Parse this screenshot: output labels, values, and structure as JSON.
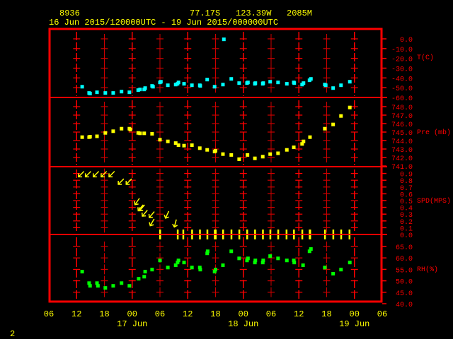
{
  "header": {
    "station": "8936",
    "latitude": "77.17S",
    "longitude": "123.39W",
    "elevation": "2085M",
    "period": "16 Jun 2015/120000UTC - 19 Jun 2015/000000UTC"
  },
  "footer": {
    "page_number": "2"
  },
  "colors": {
    "frame": "#ff0000",
    "text": "#ffff00",
    "temperature": "#00ffff",
    "pressure": "#ffff00",
    "wind": "#ffff00",
    "humidity": "#00ff00"
  },
  "chart_data": {
    "type": "scatter",
    "x_axis": {
      "unit": "hours since 16 Jun 2015 00UTC",
      "range": [
        6,
        78
      ],
      "ticks": [
        {
          "h": 6,
          "label": "06"
        },
        {
          "h": 12,
          "label": "12"
        },
        {
          "h": 18,
          "label": "18"
        },
        {
          "h": 24,
          "label": "00"
        },
        {
          "h": 30,
          "label": "06"
        },
        {
          "h": 36,
          "label": "12"
        },
        {
          "h": 42,
          "label": "18"
        },
        {
          "h": 48,
          "label": "00"
        },
        {
          "h": 54,
          "label": "06"
        },
        {
          "h": 60,
          "label": "12"
        },
        {
          "h": 66,
          "label": "18"
        },
        {
          "h": 72,
          "label": "00"
        },
        {
          "h": 78,
          "label": "06"
        }
      ],
      "date_labels": [
        {
          "h": 24,
          "label": "17 Jun"
        },
        {
          "h": 48,
          "label": "18 Jun"
        },
        {
          "h": 72,
          "label": "19 Jun"
        }
      ]
    },
    "panels": [
      {
        "name": "temperature",
        "label": "T(C)",
        "ylim": [
          -60,
          0
        ],
        "tick_labels": [
          "0.0",
          "-10.0",
          "-20.0",
          "-30.0",
          "-40.0",
          "-50.0",
          "-60.0"
        ],
        "points": [
          [
            13.2,
            -49
          ],
          [
            14.7,
            -55.4
          ],
          [
            14.9,
            -56
          ],
          [
            16.4,
            -54.7
          ],
          [
            18.2,
            -55.4
          ],
          [
            19.9,
            -55.4
          ],
          [
            21.7,
            -54
          ],
          [
            23.4,
            -54.7
          ],
          [
            25.3,
            -52.5
          ],
          [
            25.7,
            -51.8
          ],
          [
            26.6,
            -51.8
          ],
          [
            26.8,
            -50.4
          ],
          [
            28.3,
            -48.2
          ],
          [
            28.5,
            -49
          ],
          [
            30.0,
            -44.6
          ],
          [
            30.2,
            -43.9
          ],
          [
            31.7,
            -47.5
          ],
          [
            33.4,
            -46.8
          ],
          [
            33.8,
            -46
          ],
          [
            34.0,
            -44.6
          ],
          [
            35.2,
            -46
          ],
          [
            36.9,
            -47.5
          ],
          [
            38.6,
            -47.5
          ],
          [
            38.7,
            -48.2
          ],
          [
            40.2,
            -41.7
          ],
          [
            41.8,
            -49
          ],
          [
            43.6,
            -46.8
          ],
          [
            43.8,
            -0.5
          ],
          [
            45.4,
            -41
          ],
          [
            47.1,
            -45.3
          ],
          [
            48.8,
            -45.3
          ],
          [
            49.0,
            -44.6
          ],
          [
            50.5,
            -46
          ],
          [
            50.6,
            -45.3
          ],
          [
            52.2,
            -46
          ],
          [
            52.3,
            -45.3
          ],
          [
            53.8,
            -43.9
          ],
          [
            55.5,
            -44.6
          ],
          [
            57.4,
            -46
          ],
          [
            58.9,
            -44.6
          ],
          [
            59.0,
            -45.3
          ],
          [
            60.7,
            -46.8
          ],
          [
            61.0,
            -45.3
          ],
          [
            62.3,
            -42.4
          ],
          [
            62.6,
            -41
          ],
          [
            65.6,
            -46.8
          ],
          [
            65.8,
            -47.5
          ],
          [
            67.4,
            -50.4
          ],
          [
            69.1,
            -47.5
          ],
          [
            71.0,
            -43.9
          ]
        ]
      },
      {
        "name": "pressure",
        "label": "Pre (mb)",
        "ylim": [
          741,
          748
        ],
        "tick_labels": [
          "748.0",
          "747.0",
          "746.0",
          "745.0",
          "744.0",
          "743.0",
          "742.0",
          "741.0"
        ],
        "points": [
          [
            13.2,
            744.4
          ],
          [
            14.7,
            744.4
          ],
          [
            14.9,
            744.45
          ],
          [
            16.4,
            744.5
          ],
          [
            18.2,
            744.9
          ],
          [
            19.9,
            745.1
          ],
          [
            21.7,
            745.4
          ],
          [
            23.4,
            745.4
          ],
          [
            23.6,
            745.3
          ],
          [
            25.3,
            744.9
          ],
          [
            25.7,
            744.85
          ],
          [
            26.6,
            744.85
          ],
          [
            28.3,
            744.8
          ],
          [
            30.0,
            744.1
          ],
          [
            31.7,
            743.9
          ],
          [
            33.4,
            743.7
          ],
          [
            34.0,
            743.45
          ],
          [
            35.2,
            743.4
          ],
          [
            36.9,
            743.45
          ],
          [
            38.6,
            743.1
          ],
          [
            40.2,
            742.9
          ],
          [
            41.8,
            742.7
          ],
          [
            42.0,
            742.8
          ],
          [
            43.6,
            742.4
          ],
          [
            45.4,
            742.3
          ],
          [
            47.1,
            741.8
          ],
          [
            48.9,
            742.3
          ],
          [
            50.5,
            741.9
          ],
          [
            52.2,
            742.1
          ],
          [
            53.8,
            742.4
          ],
          [
            55.5,
            742.5
          ],
          [
            57.4,
            742.9
          ],
          [
            58.9,
            743.2
          ],
          [
            60.7,
            743.6
          ],
          [
            61.0,
            743.9
          ],
          [
            62.4,
            744.4
          ],
          [
            65.6,
            745.4
          ],
          [
            67.4,
            745.9
          ],
          [
            69.1,
            746.9
          ],
          [
            71.0,
            747.9
          ]
        ]
      },
      {
        "name": "wind",
        "label": "SPD(MPS)",
        "ylim": [
          0,
          1
        ],
        "tick_labels": [
          "0.9",
          "0.8",
          "0.7",
          "0.6",
          "0.5",
          "0.4",
          "0.3",
          "0.2",
          "0.1",
          "0.0"
        ],
        "points": [
          [
            12.4,
            0.85,
            45
          ],
          [
            13.9,
            0.85,
            45
          ],
          [
            15.6,
            0.85,
            45
          ],
          [
            17.3,
            0.85,
            45
          ],
          [
            19.0,
            0.85,
            45
          ],
          [
            21.0,
            0.74,
            45
          ],
          [
            22.7,
            0.74,
            45
          ],
          [
            24.6,
            0.44,
            35
          ],
          [
            25.3,
            0.35,
            40
          ],
          [
            25.6,
            0.35,
            40
          ],
          [
            26.2,
            0.27,
            40
          ],
          [
            27.7,
            0.25,
            40
          ],
          [
            27.9,
            0.13,
            30
          ],
          [
            31.2,
            0.24,
            25
          ],
          [
            33.1,
            0.11,
            15
          ],
          [
            30.0,
            0,
            0
          ],
          [
            33.8,
            0,
            0
          ],
          [
            35.0,
            0,
            0
          ],
          [
            36.9,
            0,
            0
          ],
          [
            38.6,
            0,
            0
          ],
          [
            40.2,
            0,
            0
          ],
          [
            41.8,
            0,
            0
          ],
          [
            42.0,
            0,
            0
          ],
          [
            43.6,
            0,
            0
          ],
          [
            45.4,
            0,
            0
          ],
          [
            47.1,
            0,
            0
          ],
          [
            48.8,
            0,
            0
          ],
          [
            50.5,
            0,
            0
          ],
          [
            52.2,
            0,
            0
          ],
          [
            53.8,
            0,
            0
          ],
          [
            55.5,
            0,
            0
          ],
          [
            57.3,
            0,
            0
          ],
          [
            58.9,
            0,
            0
          ],
          [
            60.7,
            0,
            0
          ],
          [
            62.3,
            0,
            0
          ],
          [
            62.4,
            0,
            0
          ],
          [
            65.6,
            0,
            0
          ],
          [
            67.4,
            0,
            0
          ],
          [
            69.1,
            0,
            0
          ],
          [
            70.9,
            0,
            0
          ]
        ]
      },
      {
        "name": "humidity",
        "label": "RH(%)",
        "ylim": [
          40,
          65
        ],
        "tick_labels": [
          "65.0",
          "60.0",
          "55.0",
          "50.0",
          "45.0",
          "40.0"
        ],
        "points": [
          [
            13.2,
            54.0
          ],
          [
            14.7,
            49.0
          ],
          [
            14.9,
            47.8
          ],
          [
            16.4,
            49.0
          ],
          [
            16.6,
            47.8
          ],
          [
            18.2,
            46.9
          ],
          [
            19.9,
            47.8
          ],
          [
            21.7,
            49.0
          ],
          [
            23.4,
            47.8
          ],
          [
            25.4,
            50.9
          ],
          [
            26.6,
            51.8
          ],
          [
            26.8,
            54.0
          ],
          [
            28.3,
            54.9
          ],
          [
            30.0,
            58.9
          ],
          [
            31.7,
            55.8
          ],
          [
            33.4,
            56.8
          ],
          [
            33.8,
            58.0
          ],
          [
            34.0,
            58.9
          ],
          [
            35.2,
            58.0
          ],
          [
            36.9,
            55.8
          ],
          [
            38.6,
            55.8
          ],
          [
            38.7,
            54.9
          ],
          [
            40.2,
            62.0
          ],
          [
            40.3,
            62.9
          ],
          [
            41.8,
            54.0
          ],
          [
            42.0,
            54.9
          ],
          [
            43.6,
            56.8
          ],
          [
            45.4,
            62.9
          ],
          [
            47.1,
            59.8
          ],
          [
            48.8,
            58.9
          ],
          [
            49.0,
            59.8
          ],
          [
            50.5,
            58.0
          ],
          [
            50.6,
            58.9
          ],
          [
            52.2,
            58.0
          ],
          [
            52.3,
            58.9
          ],
          [
            53.8,
            60.8
          ],
          [
            55.5,
            59.8
          ],
          [
            57.4,
            58.9
          ],
          [
            58.9,
            58.9
          ],
          [
            59.0,
            58.0
          ],
          [
            60.9,
            56.8
          ],
          [
            62.3,
            62.9
          ],
          [
            62.6,
            63.9
          ],
          [
            65.6,
            55.8
          ],
          [
            67.4,
            53.1
          ],
          [
            69.1,
            54.9
          ],
          [
            71.0,
            58.0
          ]
        ]
      }
    ]
  }
}
